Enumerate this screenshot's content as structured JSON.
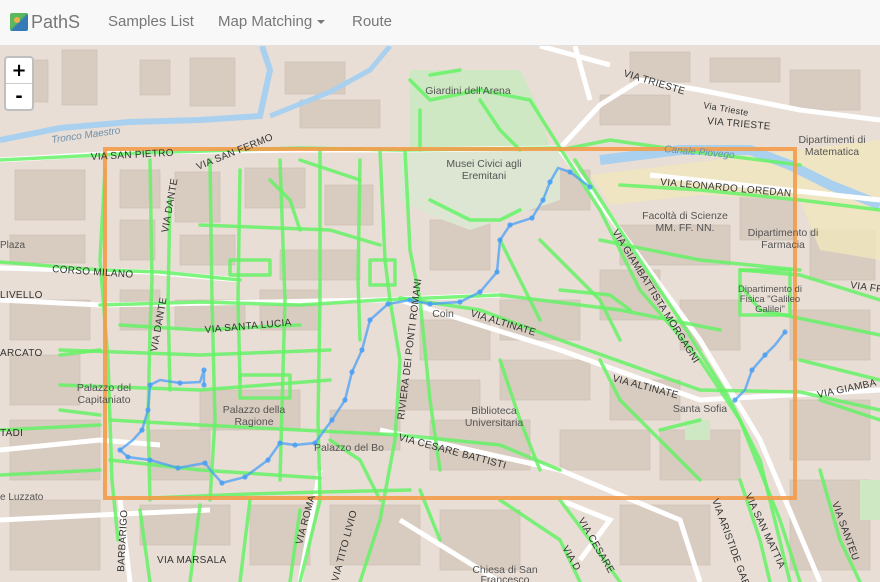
{
  "navbar": {
    "brand": "PathS",
    "items": [
      "Samples List",
      "Map Matching",
      "Route"
    ]
  },
  "zoom": {
    "in": "+",
    "out": "-"
  },
  "map": {
    "labels": {
      "via_trieste": "VIA TRIESTE",
      "via_trieste_2": "Via Trieste",
      "via_trieste_3": "VIA TRIESTE",
      "giardini": "Giardini dell'Arena",
      "dip_mat_1": "Dipartimenti di",
      "dip_mat_2": "Matematica",
      "tronco": "Tronco Maestro",
      "canale": "Canale Piovego",
      "via_san_pietro": "VIA SAN PIETRO",
      "via_san_fermo": "VIA SAN FERMO",
      "musei_1": "Musei Civici agli",
      "musei_2": "Eremitani",
      "via_leonardo": "VIA LEONARDO LOREDAN",
      "via_dante_1": "VIA DANTE",
      "facolta_1": "Facoltà di Scienze",
      "facolta_2": "MM. FF. NN.",
      "dip_farm_1": "Dipartimento di",
      "dip_farm_2": "Farmacia",
      "plaza": "Plaza",
      "corso_milano": "CORSO MILANO",
      "via_fra": "VIA FRA",
      "livello": "LIVELLO",
      "dip_fis_1": "Dipartimento di",
      "dip_fis_2": "Fisica \"Galileo",
      "dip_fis_3": "Galilei\"",
      "via_dante_2": "VIA DANTE",
      "via_santa_lucia": "VIA SANTA LUCIA",
      "coin": "Coin",
      "via_altinate_1": "VIA ALTINATE",
      "riviera": "RIVIERA DEI PONTI ROMANI",
      "gianbattista": "VIA GIAMBATTISTA MORGAGNI",
      "arcato": "ARCATO",
      "via_altinate_2": "VIA ALTINATE",
      "palazzo_cap_1": "Palazzo del",
      "palazzo_cap_2": "Capitaniato",
      "via_giamba": "VIA GIAMBA",
      "santa_sofia": "Santa Sofia",
      "palazzo_rag_1": "Palazzo della",
      "palazzo_rag_2": "Ragione",
      "biblioteca_1": "Biblioteca",
      "biblioteca_2": "Universitaria",
      "tadi": "TADI",
      "via_cesare": "VIA CESARE BATTISTI",
      "palazzo_bo": "Palazzo del Bo",
      "luzzato": "e Luzzato",
      "barbarigo": "BARBARIGO",
      "via_roma": "VIA ROMA",
      "via_livio": "VIA TITO LIVIO",
      "via_aristide": "VIA ARISTIDE GABELLI",
      "via_san_mattia": "VIA SAN MATTIA",
      "via_santeu": "VIA SANTEU",
      "via_marsala": "VIA MARSALA",
      "chiesa_1": "Chiesa di San",
      "chiesa_2": "Francesco",
      "via_cesare_2": "VIA CESARE",
      "via_d": "VIA D"
    },
    "colors": {
      "base": "#e8ded5",
      "building": "#d8cbbf",
      "road": "#ffffff",
      "water": "#a9d0ef",
      "park": "#cde8c3",
      "matched_roads": "#66f266",
      "bounding_box": "#f39c4a",
      "gps_track": "#4a9ff5"
    }
  }
}
